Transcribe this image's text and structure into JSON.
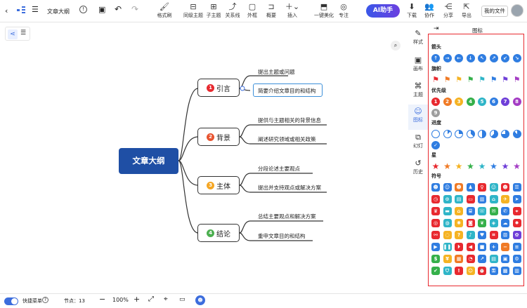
{
  "toolbar": {
    "doc_title": "文章大纲",
    "format_painter": "格式刷",
    "same_level_topic": "同级主题",
    "subtopic": "子主题",
    "relation": "关系线",
    "frame": "外框",
    "summary": "概要",
    "insert": "插入",
    "beautify": "一键美化",
    "focus": "专注",
    "ai_label": "AI助手",
    "download": "下载",
    "collaborate": "协作",
    "share": "分享",
    "export": "导出",
    "my_files": "我的文件"
  },
  "right_tabs": {
    "style": "样式",
    "canvas": "画布",
    "theme": "主题",
    "icon": "图标",
    "slides": "幻灯",
    "history": "历史"
  },
  "panel": {
    "title": "图标",
    "sections": {
      "arrow": "箭头",
      "flag": "旗帜",
      "priority": "优先级",
      "progress": "进度",
      "star": "星",
      "symbol": "符号"
    },
    "priority_numbers": [
      "1",
      "2",
      "3",
      "4",
      "5",
      "6",
      "7",
      "8",
      "9"
    ]
  },
  "mindmap": {
    "root": "文章大纲",
    "branches": [
      {
        "num": "1",
        "label": "引言",
        "color": "#e8292f",
        "children": [
          "提出主题或问题",
          "简要介绍文章目的和结构"
        ]
      },
      {
        "num": "2",
        "label": "背景",
        "color": "#e8532f",
        "children": [
          "提供与主题相关的背景信息",
          "阐述研究领域或相关政策"
        ]
      },
      {
        "num": "3",
        "label": "主体",
        "color": "#f5a623",
        "children": [
          "分段论述主要观点",
          "提出并支持观点或解决方案"
        ]
      },
      {
        "num": "4",
        "label": "结论",
        "color": "#4caf50",
        "children": [
          "总结主要观点和解决方案",
          "重申文章目的和结构"
        ]
      }
    ]
  },
  "bottom": {
    "quick_shortcut": "快捷菜单",
    "node_count": "节点：13",
    "zoom": "100%"
  },
  "colors": {
    "accent": "#3c6ddd",
    "root_bg": "#1f4fa5",
    "panel_border": "#e8292f"
  }
}
